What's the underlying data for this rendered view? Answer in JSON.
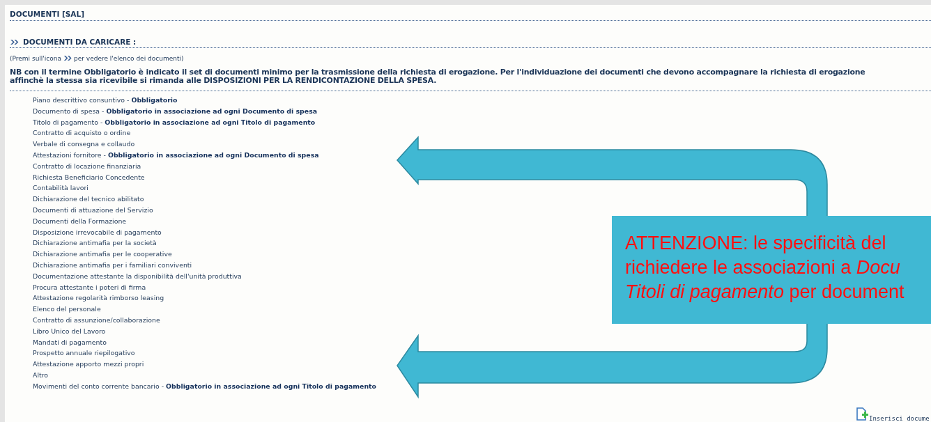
{
  "title": "DOCUMENTI [SAL]",
  "section": {
    "title": "DOCUMENTI DA CARICARE :"
  },
  "hint": {
    "before": "(Premi sull'icona",
    "after": "per vedere l'elenco dei documenti)"
  },
  "note": {
    "lines": [
      "NB con il termine Obbligatorio è indicato il set di documenti minimo per la trasmissione della richiesta di erogazione. Per l'individuazione dei documenti che devono accompagnare la richiesta di erogazione",
      "affinchè la stessa sia ricevibile si rimanda alle DISPOSIZIONI PER LA RENDICONTAZIONE DELLA SPESA."
    ]
  },
  "documents": [
    "Piano descrittivo consuntivo - **Obbligatorio**",
    "Documento di spesa - **Obbligatorio in associazione ad ogni Documento di spesa**",
    "Titolo di pagamento - **Obbligatorio in associazione ad ogni Titolo di pagamento**",
    "Contratto di acquisto o ordine",
    "Verbale di consegna e collaudo",
    "Attestazioni fornitore - **Obbligatorio in associazione ad ogni Documento di spesa**",
    "Contratto di locazione finanziaria",
    "Richiesta Beneficiario Concedente",
    "Contabilità lavori",
    "Dichiarazione del tecnico abilitato",
    "Documenti di attuazione del Servizio",
    "Documenti della Formazione",
    "Disposizione irrevocabile di pagamento",
    "Dichiarazione antimafia per la società",
    "Dichiarazione antimafia per le cooperative",
    "Dichiarazione antimafia per i familiari conviventi",
    "Documentazione attestante la disponibilità dell'unità produttiva",
    "Procura attestante i poteri di firma",
    "Attestazione regolarità rimborso leasing",
    "Elenco del personale",
    "Contratto di assunzione/collaborazione",
    "Libro Unico del Lavoro",
    "Mandati di pagamento",
    "Prospetto annuale riepilogativo",
    "Attestazione apporto mezzi propri",
    "Altro",
    "Movimenti del conto corrente bancario - **Obbligatorio in associazione ad ogni Titolo di pagamento**"
  ],
  "callout": {
    "lines": [
      "ATTENZIONE:  le specificità del",
      "richiedere le associazioni a *Docu*",
      "*Titoli di pagamento* per document"
    ]
  },
  "insert_link": "Inserisci docume"
}
